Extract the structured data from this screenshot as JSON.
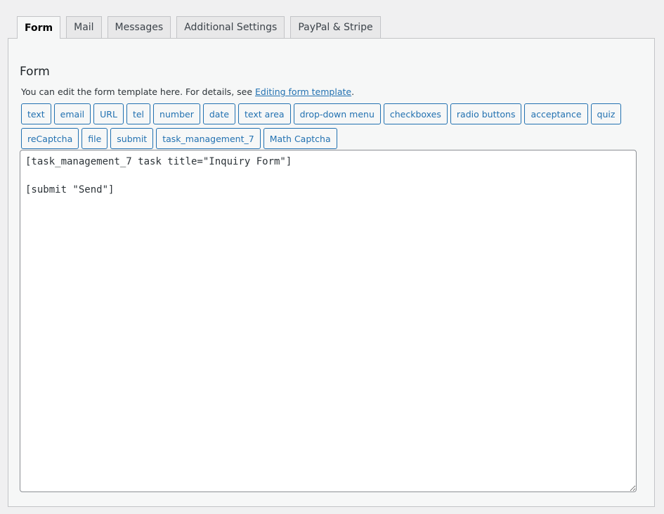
{
  "tabs": [
    {
      "label": "Form",
      "active": true
    },
    {
      "label": "Mail",
      "active": false
    },
    {
      "label": "Messages",
      "active": false
    },
    {
      "label": "Additional Settings",
      "active": false
    },
    {
      "label": "PayPal & Stripe",
      "active": false
    }
  ],
  "form_panel": {
    "title": "Form",
    "description_prefix": "You can edit the form template here. For details, see ",
    "description_link": "Editing form template",
    "description_suffix": "."
  },
  "tag_buttons": [
    "text",
    "email",
    "URL",
    "tel",
    "number",
    "date",
    "text area",
    "drop-down menu",
    "checkboxes",
    "radio buttons",
    "acceptance",
    "quiz",
    "reCaptcha",
    "file",
    "submit",
    "task_management_7",
    "Math Captcha"
  ],
  "editor": {
    "value": "[task_management_7 task title=\"Inquiry Form\"]\n\n[submit \"Send\"]"
  },
  "colors": {
    "accent": "#2271b1",
    "background": "#f0f0f1",
    "panel": "#f6f7f7",
    "border": "#c3c4c7"
  }
}
